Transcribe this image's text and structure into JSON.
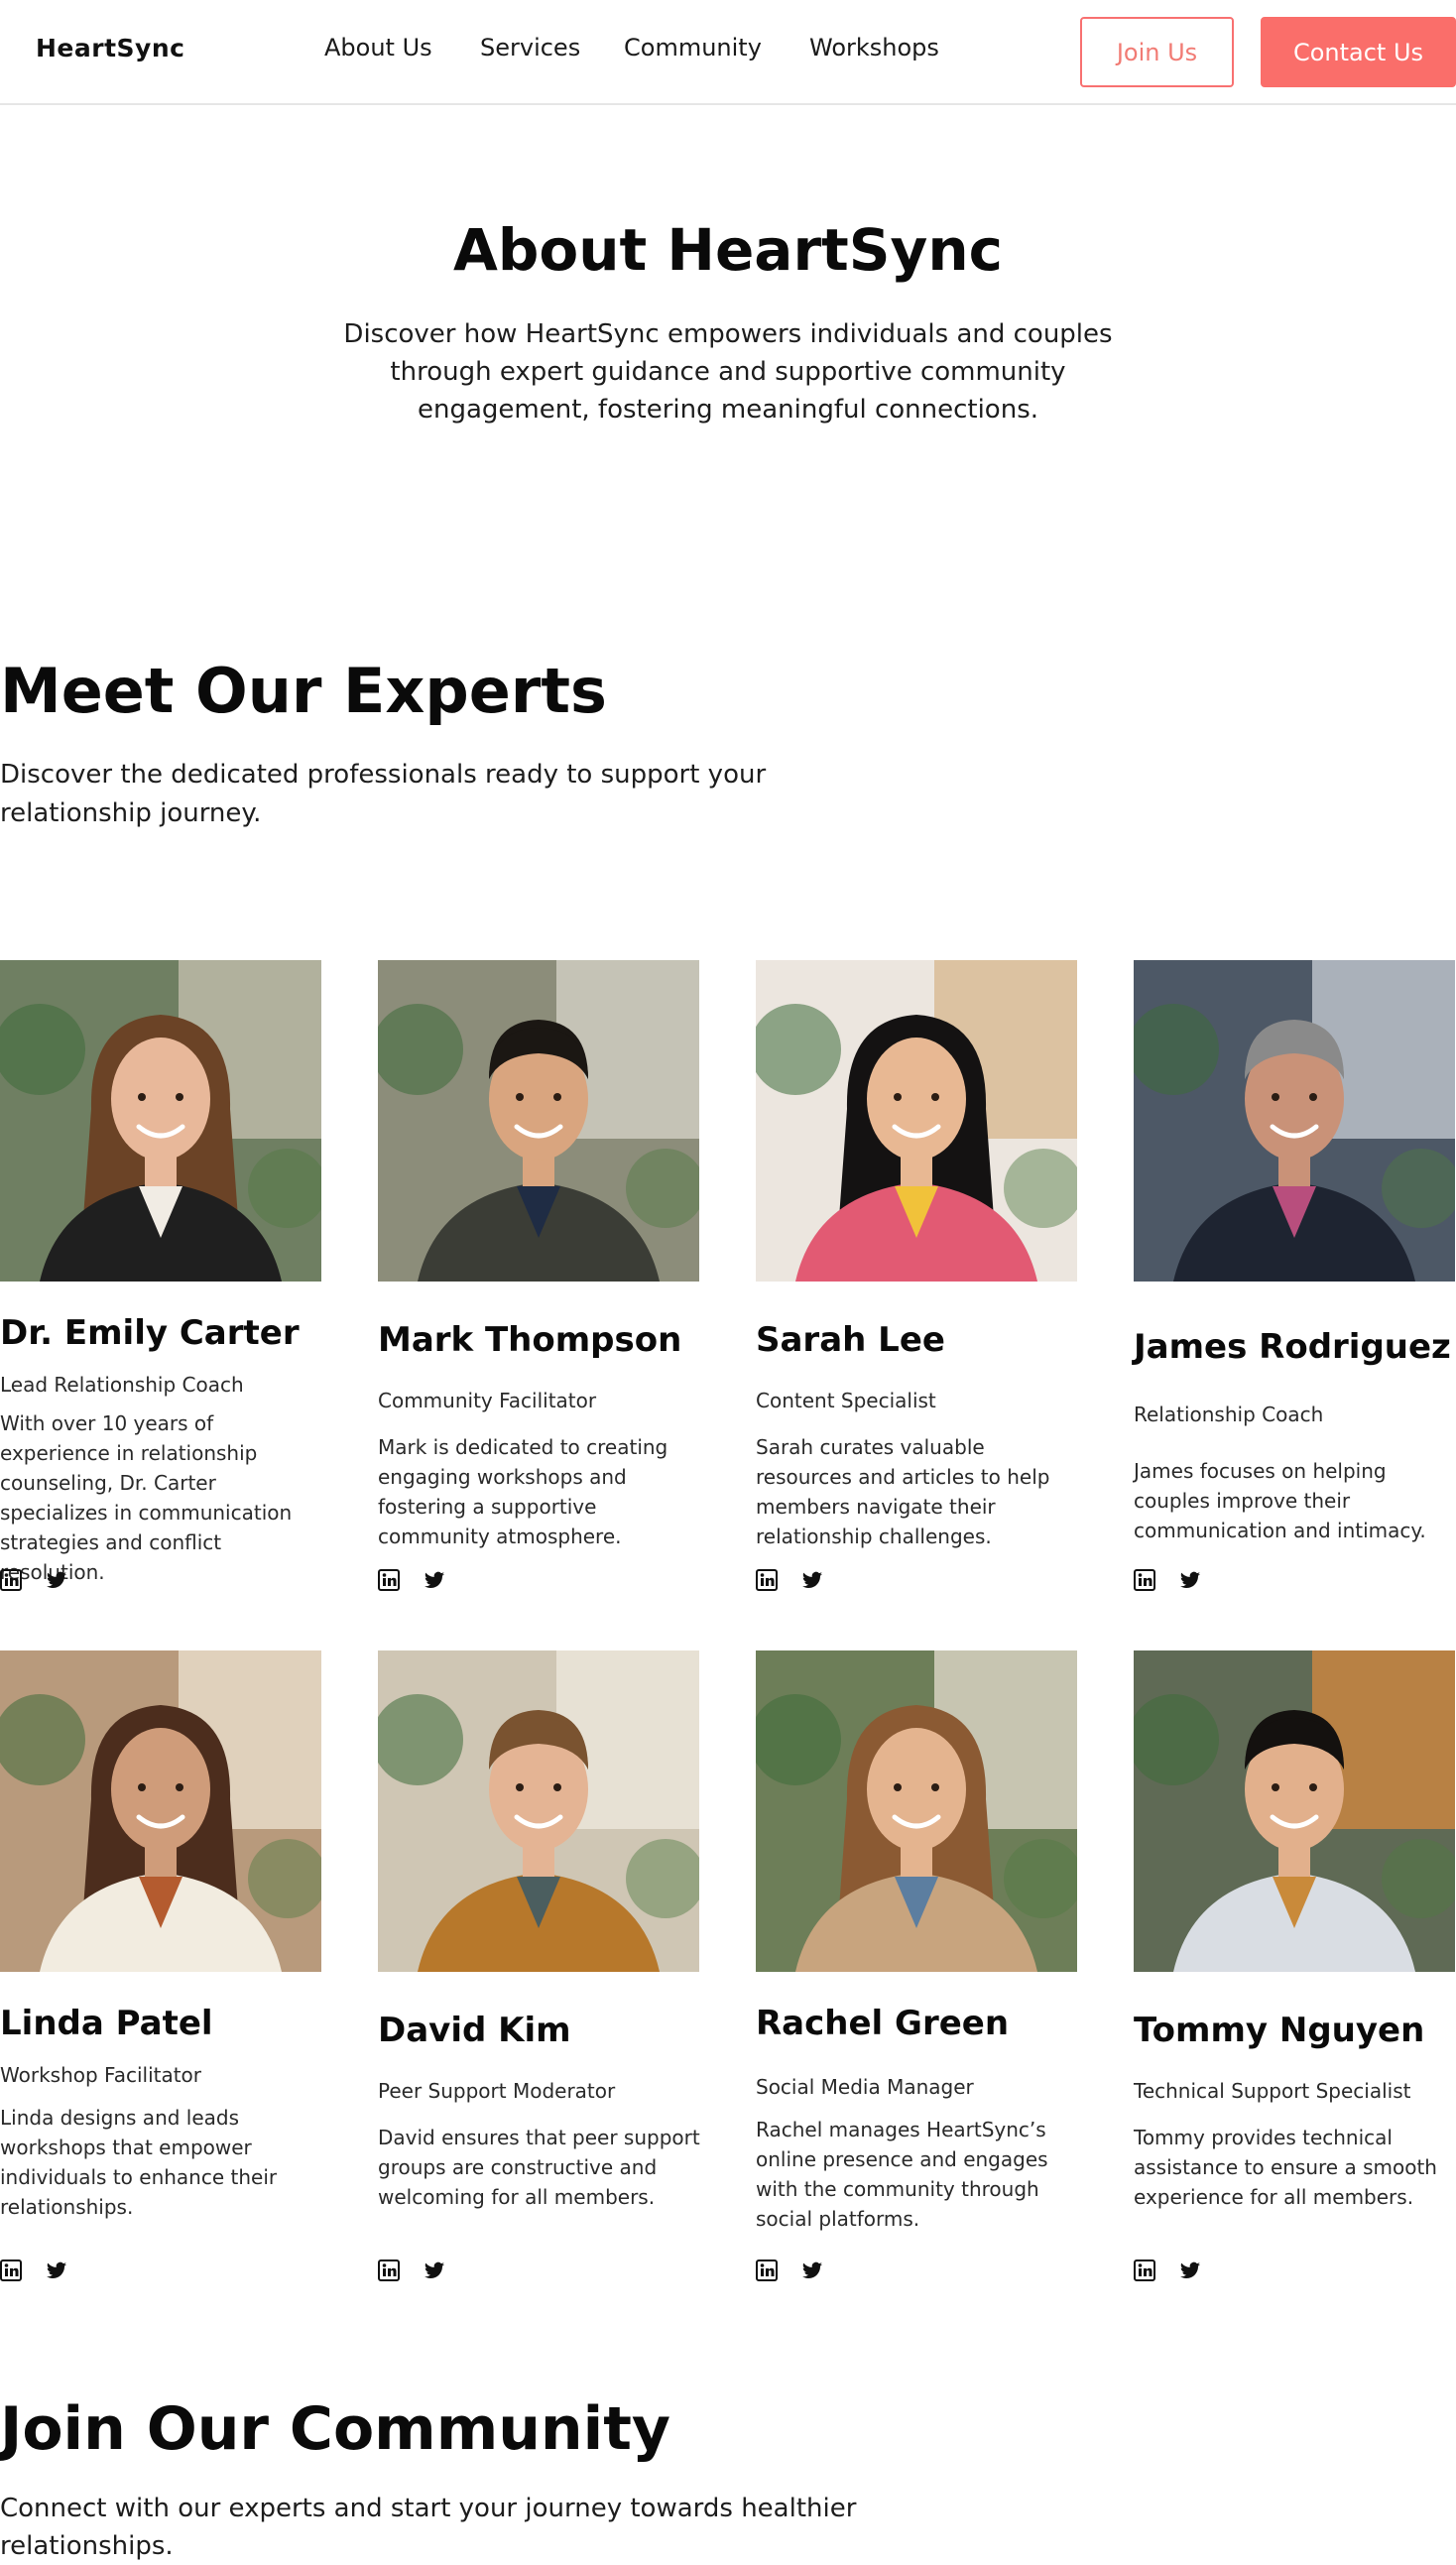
{
  "header": {
    "brand": "HeartSync",
    "nav": [
      "About Us",
      "Services",
      "Community",
      "Workshops"
    ],
    "join_label": "Join Us",
    "contact_label": "Contact Us"
  },
  "about": {
    "title": "About HeartSync",
    "text": "Discover how HeartSync empowers individuals and couples through expert guidance and supportive community engagement, fostering meaningful connections."
  },
  "experts": {
    "title": "Meet Our Experts",
    "subtitle": "Discover the dedicated professionals ready to support your relationship journey.",
    "cards": [
      {
        "name": "Dr. Emily Carter",
        "role": "Lead Relationship Coach",
        "desc": "With over 10 years of experience in relationship counseling, Dr. Carter specializes in communication strategies and conflict resolution."
      },
      {
        "name": "Mark Thompson",
        "role": "Community Facilitator",
        "desc": "Mark is dedicated to creating engaging workshops and fostering a supportive community atmosphere."
      },
      {
        "name": "Sarah Lee",
        "role": "Content Specialist",
        "desc": "Sarah curates valuable resources and articles to help members navigate their relationship challenges."
      },
      {
        "name": "James Rodriguez",
        "role": "Relationship Coach",
        "desc": "James focuses on helping couples improve their communication and intimacy."
      },
      {
        "name": "Linda Patel",
        "role": "Workshop Facilitator",
        "desc": "Linda designs and leads workshops that empower individuals to enhance their relationships."
      },
      {
        "name": "David Kim",
        "role": "Peer Support Moderator",
        "desc": "David ensures that peer support groups are constructive and welcoming for all members."
      },
      {
        "name": "Rachel Green",
        "role": "Social Media Manager",
        "desc": "Rachel manages HeartSync’s online presence and engages with the community through social platforms."
      },
      {
        "name": "Tommy Nguyen",
        "role": "Technical Support Specialist",
        "desc": "Tommy provides technical assistance to ensure a smooth experience for all members."
      }
    ],
    "social_icons": [
      "linkedin-icon",
      "twitter-icon"
    ]
  },
  "join": {
    "title": "Join Our Community",
    "subtitle": "Connect with our experts and start your journey towards healthier relationships."
  },
  "colors": {
    "accent": "#fa6e6a",
    "accent_text": "#f17b74",
    "text": "#111111",
    "divider": "#e6e6e6"
  }
}
